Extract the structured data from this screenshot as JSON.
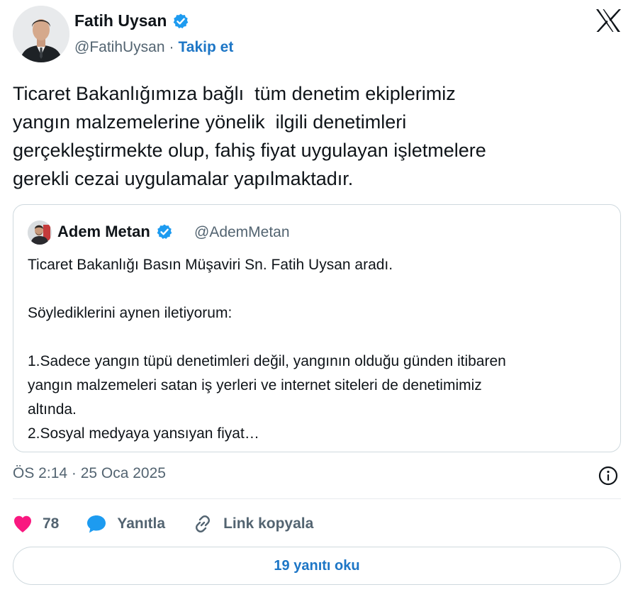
{
  "author": {
    "name": "Fatih Uysan",
    "handle": "@FatihUysan",
    "separator": "·",
    "follow_label": "Takip et",
    "verified_icon": "verified-badge-icon",
    "verified_color": "#1d9bf0"
  },
  "platform_icon": "x-logo-icon",
  "tweet": {
    "lines": [
      "Ticaret Bakanlığımıza bağlı  tüm denetim ekiplerimiz",
      "yangın malzemelerine yönelik  ilgili denetimleri",
      "gerçekleştirmekte olup, fahiş fiyat uygulayan işletmelere",
      "gerekli cezai uygulamalar yapılmaktadır."
    ]
  },
  "quote": {
    "name": "Adem Metan",
    "handle": "@AdemMetan",
    "lines": [
      "Ticaret Bakanlığı Basın Müşaviri Sn. Fatih Uysan aradı.",
      "",
      "Söylediklerini aynen iletiyorum:",
      "",
      "1.Sadece yangın tüpü denetimleri değil, yangının olduğu günden itibaren",
      "yangın malzemeleri satan iş yerleri ve internet siteleri de denetimimiz",
      "altında.",
      "2.Sosyal medyaya yansıyan fiyat…"
    ]
  },
  "meta": {
    "timestamp": "ÖS 2:14 · 25 Oca 2025",
    "info_icon": "info-icon"
  },
  "actions": {
    "like_count": "78",
    "reply_label": "Yanıtla",
    "copy_link_label": "Link kopyala",
    "like_color": "#f91880",
    "reply_color": "#1d9bf0"
  },
  "read_replies_label": "19 yanıtı oku",
  "colors": {
    "accent": "#1d76c6",
    "secondary_text": "#536471",
    "border": "#cfd9de"
  }
}
